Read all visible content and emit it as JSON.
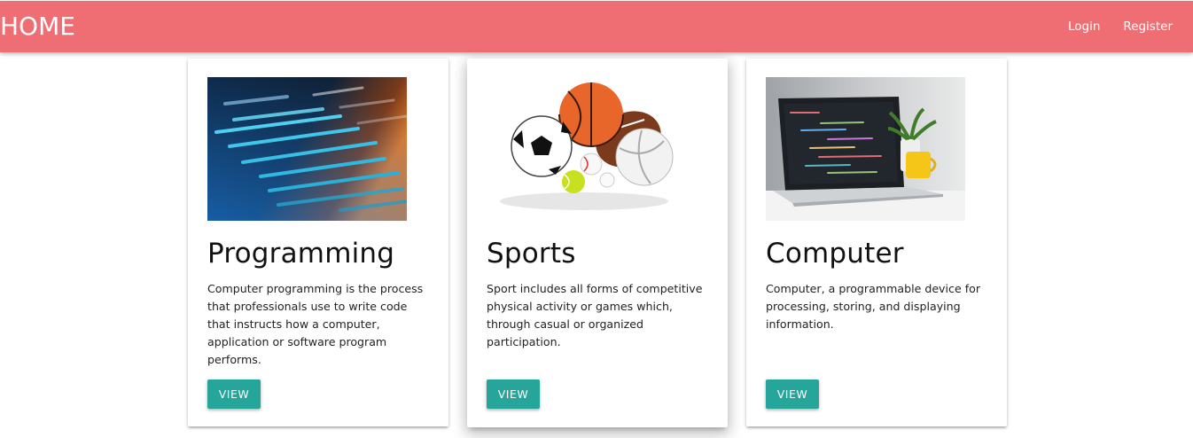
{
  "navbar": {
    "brand": "HOME",
    "links": [
      "Login",
      "Register"
    ],
    "color": "#ee6e73"
  },
  "cards": [
    {
      "title": "Programming",
      "text": "Computer programming is the process that professionals use to write code that instructs how a computer, application or software program performs.",
      "button": "VIEW",
      "image": "code-screen-image"
    },
    {
      "title": "Sports",
      "text": "Sport includes all forms of competitive physical activity or games which, through casual or organized participation.",
      "button": "VIEW",
      "image": "sports-balls-image"
    },
    {
      "title": "Computer",
      "text": "Computer, a programmable device for processing, storing, and displaying information.",
      "button": "VIEW",
      "image": "laptop-image"
    }
  ],
  "accent": "#26a69a"
}
